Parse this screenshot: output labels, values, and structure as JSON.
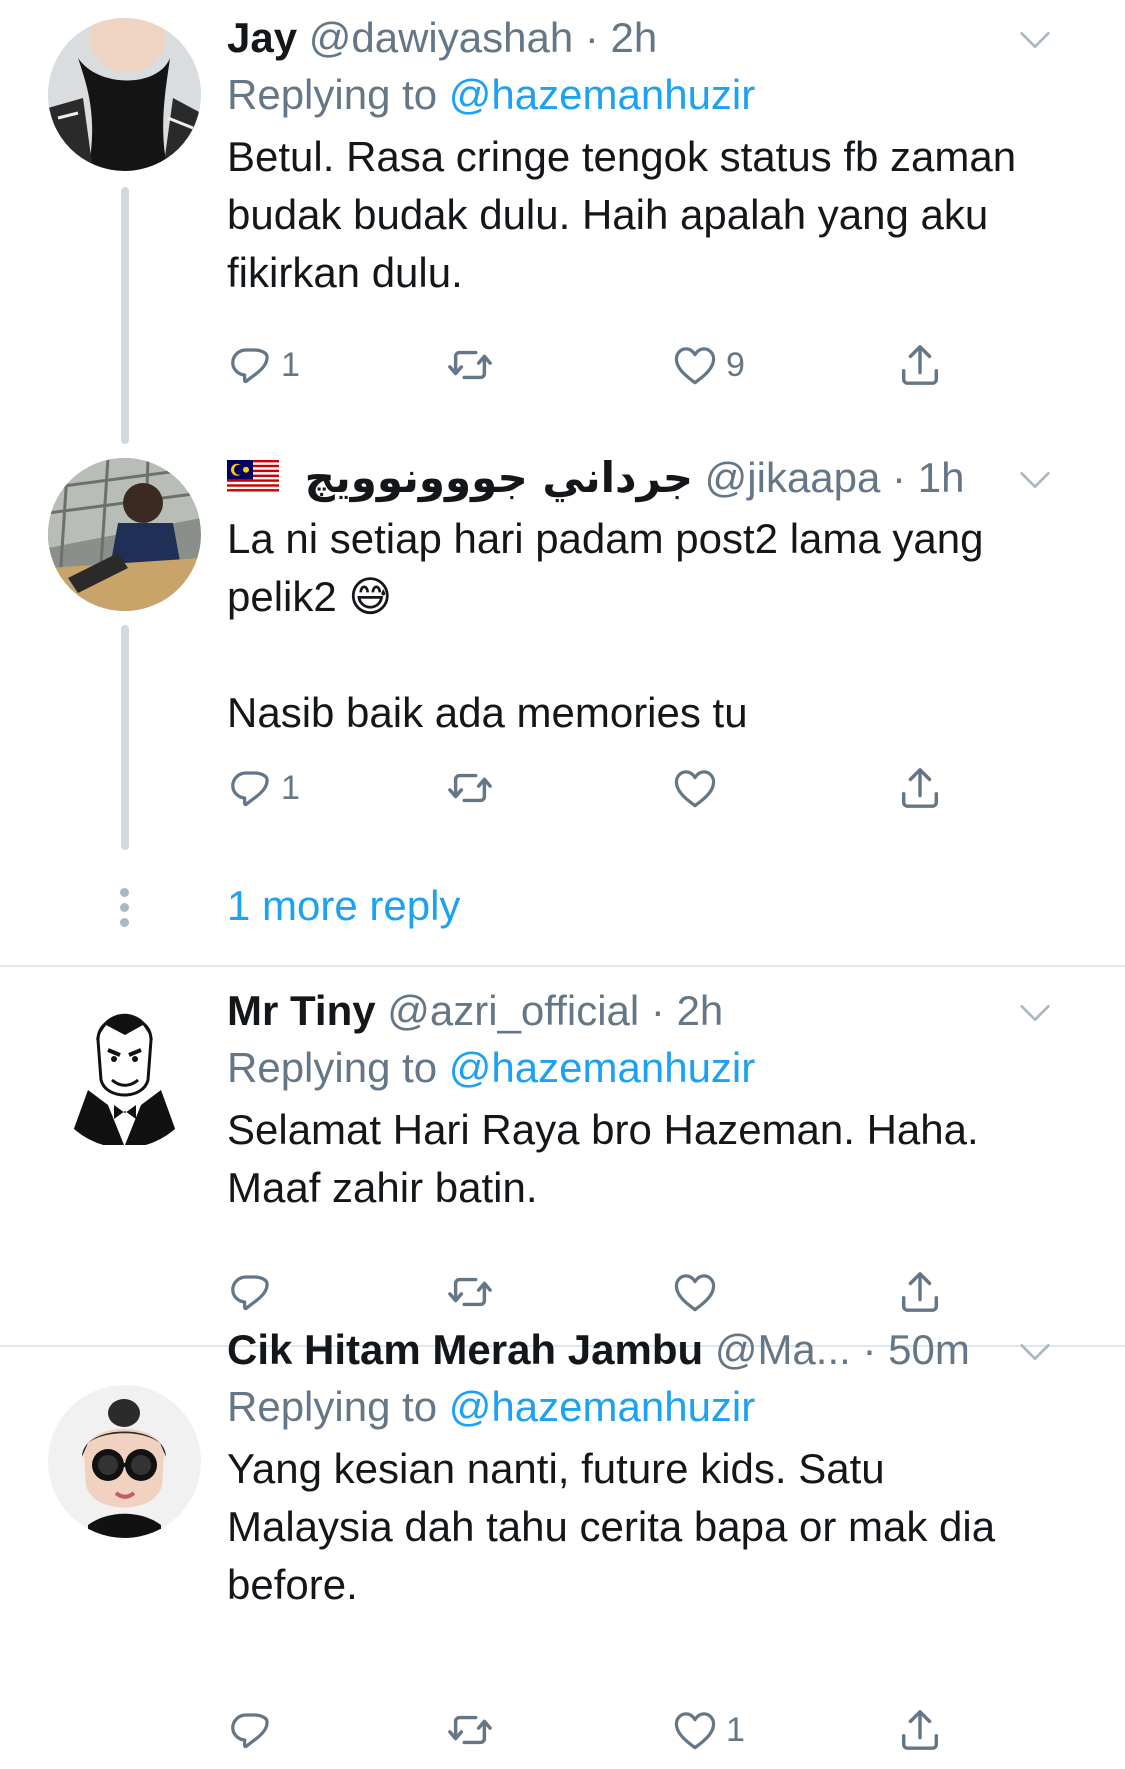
{
  "tweets": [
    {
      "name": "Jay",
      "handle": "@dawiyashah",
      "dot": "·",
      "time": "2h",
      "replying_label": "Replying to",
      "replying_to": "@hazemanhuzir",
      "text": "Betul. Rasa cringe tengok status fb zaman budak budak dulu. Haih apalah yang aku fikirkan dulu.",
      "reply_count": "1",
      "retweet_count": "",
      "like_count": "9"
    },
    {
      "name": "جرداني جووونوويچ",
      "handle": "@jikaapa",
      "dot": "·",
      "time": "1h",
      "text_line1": "La ni setiap hari padam post2 lama yang pelik2",
      "emoji": "😅",
      "text_line2": "Nasib baik ada memories tu",
      "reply_count": "1",
      "retweet_count": "",
      "like_count": ""
    },
    {
      "name": "Mr Tiny",
      "handle": "@azri_official",
      "dot": "·",
      "time": "2h",
      "replying_label": "Replying to",
      "replying_to": "@hazemanhuzir",
      "text": "Selamat Hari Raya bro Hazeman. Haha. Maaf zahir batin.",
      "reply_count": "",
      "retweet_count": "",
      "like_count": ""
    },
    {
      "name": "Cik Hitam Merah Jambu",
      "handle": "@Ma...",
      "dot": "·",
      "time": "50m",
      "replying_label": "Replying to",
      "replying_to": "@hazemanhuzir",
      "text": "Yang kesian nanti, future kids. Satu Malaysia dah tahu cerita bapa or mak dia before.",
      "reply_count": "",
      "retweet_count": "",
      "like_count": "1"
    }
  ],
  "more_replies": "1 more reply",
  "colors": {
    "link": "#1da1f2",
    "muted": "#657786",
    "line": "#cfd9de"
  }
}
